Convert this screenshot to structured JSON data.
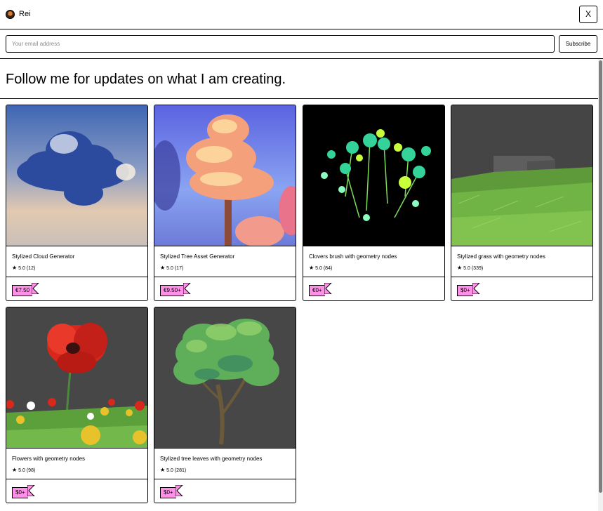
{
  "header": {
    "creator_name": "Rei",
    "close_label": "X"
  },
  "subscribe": {
    "placeholder": "Your email address",
    "button_label": "Subscribe"
  },
  "headline": "Follow me for updates on what I am creating.",
  "products": [
    {
      "title": "Stylized Cloud Generator",
      "rating": "5.0 (12)",
      "price": "€7.50",
      "thumbnail": "blue-cloud"
    },
    {
      "title": "Stylized Tree Asset Generator",
      "rating": "5.0 (17)",
      "price": "€9.50+",
      "thumbnail": "pink-tree"
    },
    {
      "title": "Clovers brush with geometry nodes",
      "rating": "5.0 (84)",
      "price": "€0+",
      "thumbnail": "glowing-clovers"
    },
    {
      "title": "Stylized grass with geometry nodes",
      "rating": "5.0 (339)",
      "price": "$0+",
      "thumbnail": "grass-and-cube"
    },
    {
      "title": "Flowers with geometry nodes",
      "rating": "5.0 (98)",
      "price": "$0+",
      "thumbnail": "red-poppy"
    },
    {
      "title": "Stylized tree leaves with geometry nodes",
      "rating": "5.0 (281)",
      "price": "$0+",
      "thumbnail": "green-tree"
    }
  ],
  "icons": {
    "star": "star-icon",
    "avatar": "creator-avatar"
  },
  "colors": {
    "price_tag": "#ff90e8",
    "border": "#000000"
  }
}
